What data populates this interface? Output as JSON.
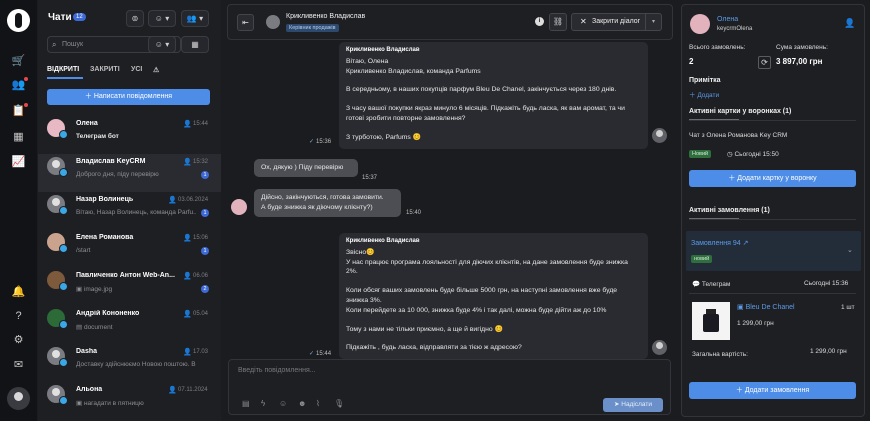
{
  "rail": {
    "icons": [
      "logo-icon",
      "cart-icon",
      "users-icon",
      "clipboard-icon",
      "boxes-icon",
      "chart-icon",
      "bell-icon",
      "help-icon",
      "settings-icon",
      "inbox-icon",
      "profile-icon"
    ]
  },
  "list": {
    "title": "Чати",
    "count": "12",
    "search_placeholder": "Пошук",
    "tabs": [
      "ВІДКРИТІ",
      "ЗАКРИТІ",
      "УСІ",
      "⚠"
    ],
    "write_button": "Написати повідомлення",
    "conversations": [
      {
        "name": "Олена",
        "preview": "Телеграм бот",
        "time": "15:44",
        "count": ""
      },
      {
        "name": "Владислав KeyCRM",
        "preview": "Доброго дня, піду перевірю",
        "time": "15:32",
        "count": "1"
      },
      {
        "name": "Назар Волинець",
        "preview": "Вітаю, Назар Волинець, команда Parfu...",
        "time": "03.06.2024",
        "count": "1"
      },
      {
        "name": "Елена Романова",
        "preview": "/start",
        "time": "15:06",
        "count": "1"
      },
      {
        "name": "Павличенко Антон Web-An...",
        "preview": "image.jpg",
        "time": "06.06",
        "count": "2"
      },
      {
        "name": "Андрій Кононенко",
        "preview": "document",
        "time": "05.04",
        "count": ""
      },
      {
        "name": "Dasha",
        "preview": "Доставку здійснюємо Новою поштою. Вих...",
        "time": "17.03",
        "count": ""
      },
      {
        "name": "Альона",
        "preview": "нагадати в пятницю",
        "time": "07.11.2024",
        "count": ""
      }
    ]
  },
  "chat": {
    "contact_name": "Крикливенко Владислав",
    "contact_tag": "Керівник продажів",
    "close_button": "Закрити діалог",
    "messages": [
      {
        "author": "Крикливенко Владислав",
        "lines": [
          "Вітаю, Олена",
          "Крикливенко Владислав, команда Parfums",
          "",
          "В середньому, в наших покупців парфум Bleu De Chanel, закінчується через 180 днів.",
          "",
          "З часу вашої покупки якраз минуло 6 місяців. Підкажіть будь ласка, як вам аромат, та чи готові зробити повторне замовлення?",
          "",
          "З турботою, Parfums 😊"
        ],
        "time": "15:36"
      },
      {
        "lines": [
          "Ох, дякую ) Піду перевірю"
        ],
        "time": "15:37"
      },
      {
        "lines": [
          "Дійсно, закінчуються, готова замовити.",
          "А буде знижка як діючому клієнту?)"
        ],
        "time": "15:40"
      },
      {
        "author": "Крикливенко Владислав",
        "lines": [
          "Звісно😊",
          "У нас працює програма лояльності для діючих клієнтів, на дане замовлення буде знижка 2%.",
          "",
          "Коли обсяг ваших замовлень буде більше 5000 грн, на наступні замовлення вже буде знижка 3%.",
          "Коли перейдете за 10 000, знижка буде 4% і так далі, можна буде дійти аж до 10%",
          "",
          "Тому з нами не тільки приємно, а ще й вигідно 😊",
          "",
          "Підкажіть , будь ласка, відправляти за тією ж адресою?"
        ],
        "time": "15:44"
      }
    ],
    "composer_placeholder": "Введіть повідомлення...",
    "send_button": "Надіслати"
  },
  "panel": {
    "name": "Олена",
    "nick": "keycrmOlena",
    "orders_label": "Всього замовлень:",
    "orders_value": "2",
    "sum_label": "Сума замовлень:",
    "sum_value": "3 897,00 грн",
    "note_label": "Примітка",
    "add_link": "Додати",
    "active_cards_title": "Активні картки у воронках (1)",
    "card_title": "Чат з Олена Романова Key CRM",
    "card_status": "Новий",
    "card_time": "Сьогодні 15:50",
    "add_card_button": "Додати картку у воронку",
    "active_orders_title": "Активні замовлення (1)",
    "order_title": "Замовлення 94",
    "order_status": "новий",
    "source": "Телеграм",
    "source_time": "Сьогодні 15:36",
    "product_name": "Bleu De Chanel",
    "product_qty": "1 шт",
    "product_price": "1 299,00 грн",
    "total_label": "Загальна вартість:",
    "total_value": "1 299,00 грн",
    "add_order_button": "Додати замовлення"
  },
  "colors": {
    "accent": "#4d8de8",
    "link": "#5c9be8",
    "success": "#3fb46a",
    "alert": "#e5484d"
  }
}
